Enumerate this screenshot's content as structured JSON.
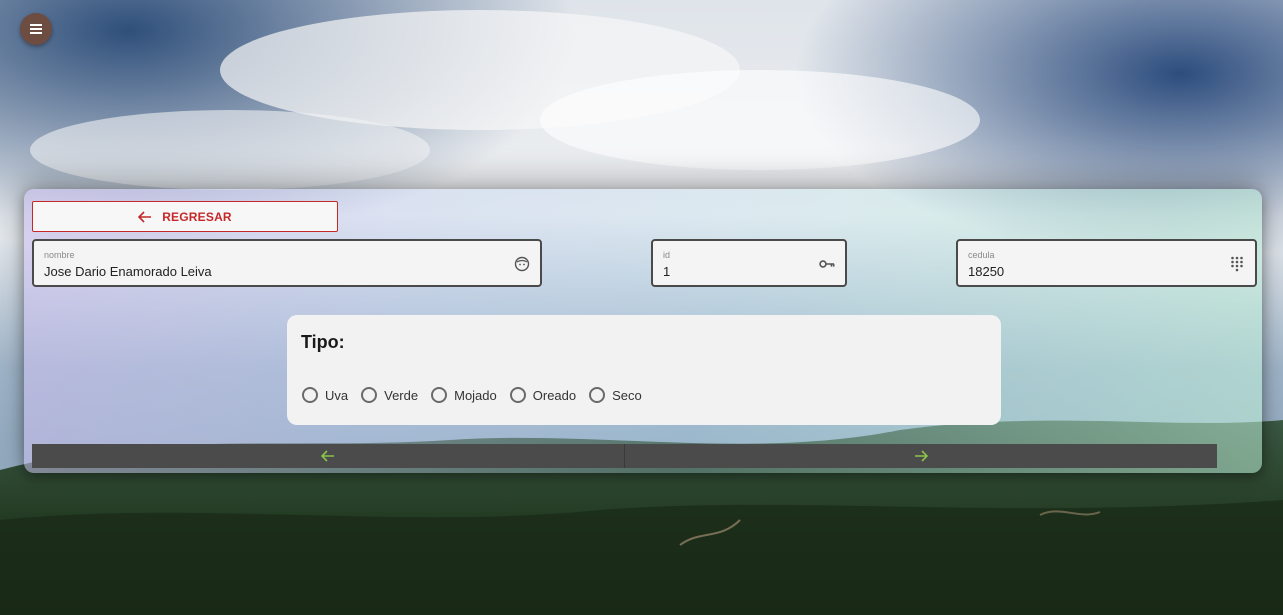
{
  "app": {
    "menu_icon": "hamburger-menu-icon"
  },
  "back_button": {
    "label": "REGRESAR",
    "icon": "arrow-left-icon",
    "color": "#c62828"
  },
  "fields": {
    "nombre": {
      "label": "nombre",
      "value": "Jose Dario Enamorado Leiva",
      "icon": "face-icon"
    },
    "id": {
      "label": "id",
      "value": "1",
      "icon": "key-icon"
    },
    "cedula": {
      "label": "cedula",
      "value": "18250",
      "icon": "dialpad-icon"
    }
  },
  "tipo": {
    "title": "Tipo:",
    "options": [
      "Uva",
      "Verde",
      "Mojado",
      "Oreado",
      "Seco"
    ]
  },
  "navigation": {
    "prev_icon": "arrow-left-icon",
    "next_icon": "arrow-right-icon",
    "arrow_color": "#8bc34a"
  }
}
